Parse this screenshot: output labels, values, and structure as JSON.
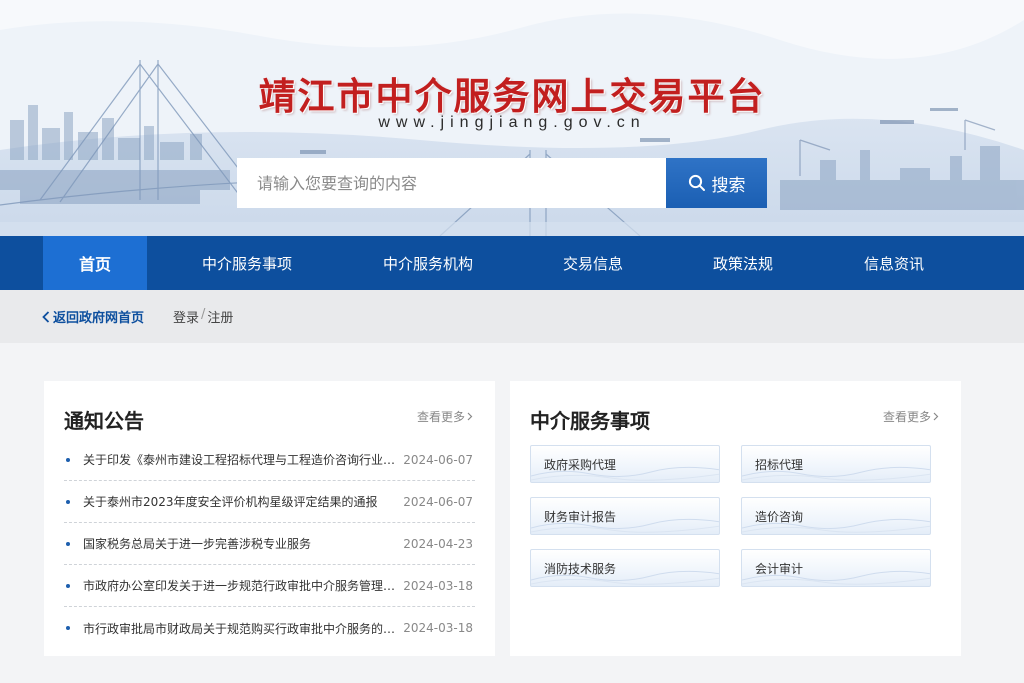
{
  "header": {
    "title": "靖江市中介服务网上交易平台",
    "url": "www.jingjiang.gov.cn"
  },
  "search": {
    "placeholder": "请输入您要查询的内容",
    "button_label": "搜索"
  },
  "nav": {
    "items": [
      {
        "label": "首页",
        "active": true
      },
      {
        "label": "中介服务事项",
        "active": false
      },
      {
        "label": "中介服务机构",
        "active": false
      },
      {
        "label": "交易信息",
        "active": false
      },
      {
        "label": "政策法规",
        "active": false
      },
      {
        "label": "信息资讯",
        "active": false
      }
    ]
  },
  "subbar": {
    "back_label": "返回政府网首页",
    "login_label": "登录",
    "separator": "/",
    "register_label": "注册"
  },
  "notice": {
    "title": "通知公告",
    "more_label": "查看更多",
    "items": [
      {
        "text": "关于印发《泰州市建设工程招标代理与工程造价咨询行业信用评价管理办法》的通知",
        "date": "2024-06-07"
      },
      {
        "text": "关于泰州市2023年度安全评价机构星级评定结果的通报",
        "date": "2024-06-07"
      },
      {
        "text": "国家税务总局关于进一步完善涉税专业服务",
        "date": "2024-04-23"
      },
      {
        "text": "市政府办公室印发关于进一步规范行政审批中介服务管理的通知",
        "date": "2024-03-18"
      },
      {
        "text": "市行政审批局市财政局关于规范购买行政审批中介服务的通知",
        "date": "2024-03-18"
      }
    ]
  },
  "services": {
    "title": "中介服务事项",
    "more_label": "查看更多",
    "items": [
      {
        "label": "政府采购代理"
      },
      {
        "label": "招标代理"
      },
      {
        "label": "财务审计报告"
      },
      {
        "label": "造价咨询"
      },
      {
        "label": "消防技术服务"
      },
      {
        "label": "会计审计"
      }
    ]
  },
  "colors": {
    "nav_bg": "#0d4f9e",
    "nav_active": "#1d6fd3",
    "title_red": "#c21f1f",
    "accent_blue": "#1b5fb3"
  }
}
